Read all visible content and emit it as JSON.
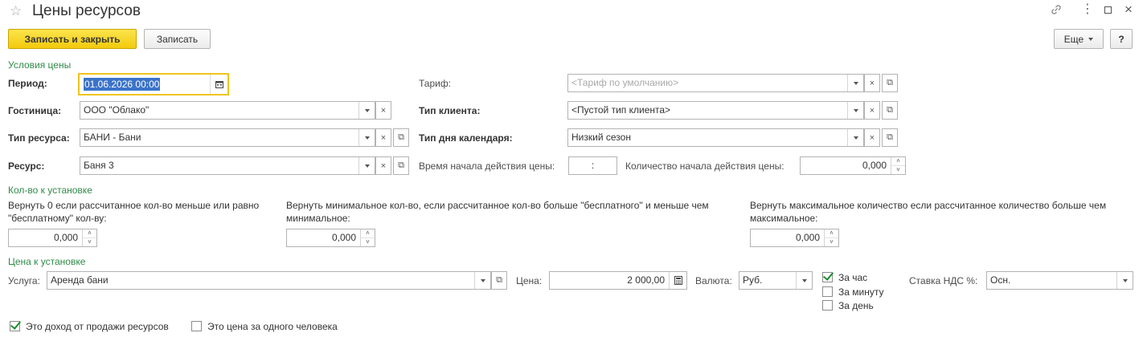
{
  "window": {
    "title": "Цены ресурсов"
  },
  "toolbar": {
    "save_close": "Записать и закрыть",
    "save": "Записать",
    "more": "Еще",
    "help": "?"
  },
  "sections": {
    "price_conditions": "Условия цены",
    "qty_to_set": "Кол-во к установке",
    "price_to_set": "Цена к установке"
  },
  "conditions": {
    "period": {
      "label": "Период:",
      "value": "01.06.2026 00:00"
    },
    "tariff": {
      "label": "Тариф:",
      "placeholder": "<Тариф по умолчанию>"
    },
    "hotel": {
      "label": "Гостиница:",
      "value": "ООО \"Облако\""
    },
    "client_type": {
      "label": "Тип клиента:",
      "value": "<Пустой тип клиента>"
    },
    "resource_type": {
      "label": "Тип ресурса:",
      "value": "БАНИ - Бани"
    },
    "day_type": {
      "label": "Тип дня календаря:",
      "value": "Низкий сезон"
    },
    "resource": {
      "label": "Ресурс:",
      "value": "Баня 3"
    },
    "start_time": {
      "label": "Время начала действия цены:",
      "value": " : "
    },
    "start_qty": {
      "label": "Количество начала действия цены:",
      "value": "0,000"
    }
  },
  "qty": {
    "zero": {
      "label": "Вернуть 0 если рассчитанное кол-во меньше или равно \"бесплатному\" кол-ву:",
      "value": "0,000"
    },
    "min": {
      "label": "Вернуть минимальное кол-во, если рассчитанное кол-во больше \"бесплатного\" и меньше чем минимальное:",
      "value": "0,000"
    },
    "max": {
      "label": "Вернуть максимальное количество если рассчитанное количество больше чем максимальное:",
      "value": "0,000"
    }
  },
  "price": {
    "service": {
      "label": "Услуга:",
      "value": "Аренда бани"
    },
    "price": {
      "label": "Цена:",
      "value": "2 000,00"
    },
    "currency": {
      "label": "Валюта:",
      "value": "Руб."
    },
    "per_hour": {
      "label": "За час",
      "checked": true
    },
    "per_minute": {
      "label": "За минуту",
      "checked": false
    },
    "per_day": {
      "label": "За день",
      "checked": false
    },
    "vat": {
      "label": "Ставка НДС %:",
      "value": "Осн."
    }
  },
  "footer": {
    "income": {
      "label": "Это доход от продажи ресурсов",
      "checked": true
    },
    "per_person": {
      "label": "Это цена за одного человека",
      "checked": false
    }
  }
}
